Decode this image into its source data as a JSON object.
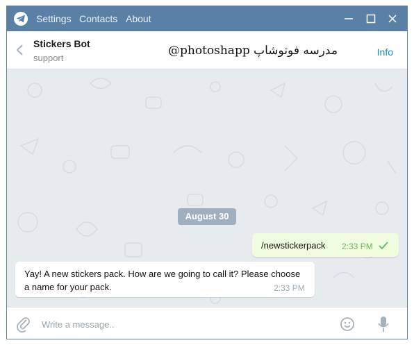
{
  "window": {
    "menu": [
      "Settings",
      "Contacts",
      "About"
    ]
  },
  "chat": {
    "name": "Stickers Bot",
    "status": "support",
    "info_label": "Info",
    "watermark": "@photoshapp   مدرسه فوتوشاپ"
  },
  "messages": {
    "date_badge": "August 30",
    "outgoing": {
      "text": "/newstickerpack",
      "time": "2:33 PM"
    },
    "incoming": {
      "text": "Yay! A new stickers pack. How are we going to call it? Please choose a name for your pack.",
      "time": "2:33 PM"
    }
  },
  "composer": {
    "placeholder": "Write a message.."
  },
  "colors": {
    "titlebar": "#5a80a6",
    "chat_background": "#e6ebee",
    "outgoing_bubble": "#effdde",
    "accent": "#168acd"
  }
}
